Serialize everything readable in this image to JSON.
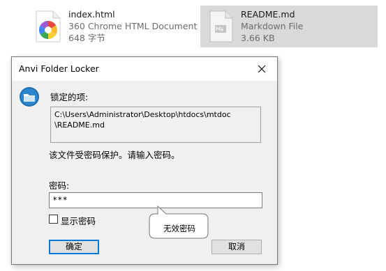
{
  "files": [
    {
      "name": "index.html",
      "type": "360 Chrome HTML Document",
      "size": "648 字节",
      "icon": "chrome-html-file-icon",
      "selected": false
    },
    {
      "name": "README.md",
      "type": "Markdown File",
      "size": "3.66 KB",
      "icon": "markdown-file-icon",
      "selected": true
    }
  ],
  "dialog": {
    "title": "Anvi Folder Locker",
    "locked_item_label": "锁定的项:",
    "path_lines": [
      "C:\\Users\\Administrator\\Desktop\\htdocs\\mtdoc",
      "\\README.md"
    ],
    "message": "该文件受密码保护。请输入密码。",
    "password_label": "密码:",
    "password_value": "***",
    "show_password_label": "显示密码",
    "show_password_checked": false,
    "ok_label": "确定",
    "cancel_label": "取消",
    "tooltip": "无效密码"
  },
  "colors": {
    "accent": "#0078d7",
    "selected_tile": "#d9d9d9",
    "dialog_bg": "#f0f0f0"
  }
}
